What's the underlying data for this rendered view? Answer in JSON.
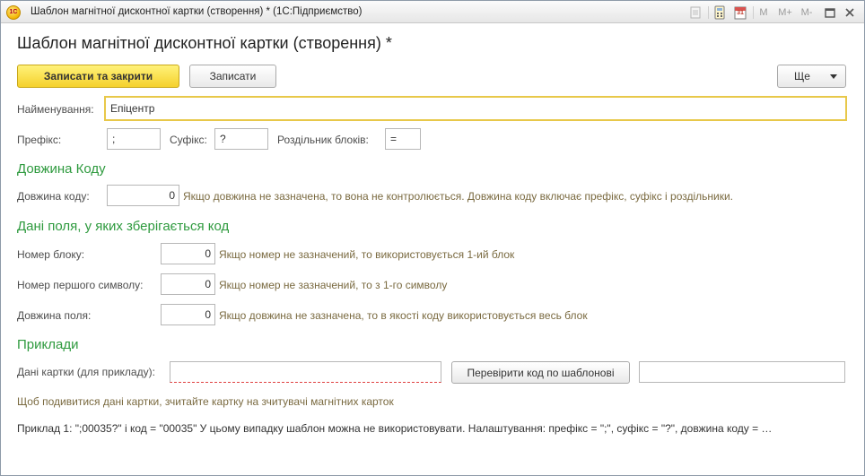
{
  "window": {
    "title": "Шаблон магнітної дисконтної картки (створення) *  (1С:Підприємство)",
    "app_logo_text": "1С",
    "toolbar_icons": [
      "document-icon",
      "calculator-icon",
      "calendar-icon"
    ],
    "memory_buttons": [
      "M",
      "M+",
      "M-"
    ],
    "calendar_day": "31"
  },
  "form": {
    "title": "Шаблон магнітної дисконтної картки (створення) *",
    "buttons": {
      "save_close": "Записати та закрити",
      "save": "Записати",
      "more": "Ще"
    },
    "name": {
      "label": "Найменування:",
      "value": "Епіцентр"
    },
    "prefix": {
      "label": "Префікс:",
      "value": ";"
    },
    "suffix": {
      "label": "Суфікс:",
      "value": "?"
    },
    "separator": {
      "label": "Роздільник блоків:",
      "value": "="
    },
    "code_length_section": {
      "title": "Довжина Коду",
      "label": "Довжина коду:",
      "value": "0",
      "hint": "Якщо довжина не зазначена, то вона не контролюється. Довжина коду включає префікс, суфікс і роздільники."
    },
    "fields_section": {
      "title": "Дані поля, у яких зберігається код",
      "block_number": {
        "label": "Номер блоку:",
        "value": "0",
        "hint": "Якщо номер не зазначений, то використовується 1-ий блок"
      },
      "first_symbol": {
        "label": "Номер першого символу:",
        "value": "0",
        "hint": "Якщо номер не зазначений, то з 1-го символу"
      },
      "field_length": {
        "label": "Довжина поля:",
        "value": "0",
        "hint": "Якщо довжина не зазначена, то в якості коду використовується весь блок"
      }
    },
    "examples_section": {
      "title": "Приклади",
      "card_data_label": "Дані картки (для прикладу):",
      "card_data_value": "",
      "check_button": "Перевірити код по шаблонові",
      "result_value": "",
      "read_hint": "Щоб подивитися дані картки, зчитайте картку на зчитувачі магнітних карток",
      "example_text": "Приклад 1: \";00035?\" і код = \"00035\" У цьому випадку шаблон можна не використовувати. Налаштування: префікс = \";\", суфікс = \"?\", довжина коду = …"
    }
  },
  "colors": {
    "section_title": "#2e9a3e",
    "hint_text": "#7a6a40",
    "primary_button": "#f5d12c",
    "focus_border": "#e8c84a"
  }
}
